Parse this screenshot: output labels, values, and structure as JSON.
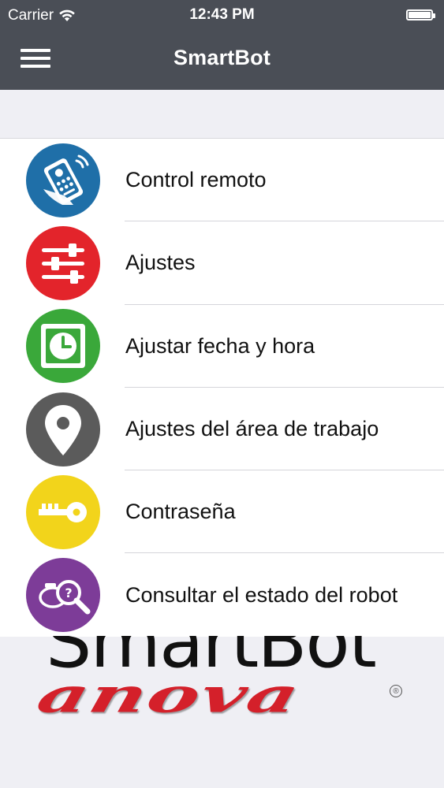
{
  "status_bar": {
    "carrier": "Carrier",
    "time": "12:43 PM"
  },
  "nav": {
    "title": "SmartBot",
    "menu_icon": "hamburger-icon"
  },
  "menu": {
    "items": [
      {
        "label": "Control remoto",
        "icon": "remote-control-icon",
        "color": "#1f6fa8"
      },
      {
        "label": "Ajustes",
        "icon": "sliders-icon",
        "color": "#e3242b"
      },
      {
        "label": "Ajustar fecha y hora",
        "icon": "clock-icon",
        "color": "#3aa83a"
      },
      {
        "label": "Ajustes del área de trabajo",
        "icon": "location-pin-icon",
        "color": "#5b5b5b"
      },
      {
        "label": "Contraseña",
        "icon": "key-icon",
        "color": "#f2d41b"
      },
      {
        "label": "Consultar el estado del robot",
        "icon": "robot-status-search-icon",
        "color": "#7d3c98"
      }
    ]
  },
  "branding": {
    "top_text": "SmartBot",
    "main_text": "anova",
    "registered": "®",
    "main_color": "#d4202a"
  }
}
